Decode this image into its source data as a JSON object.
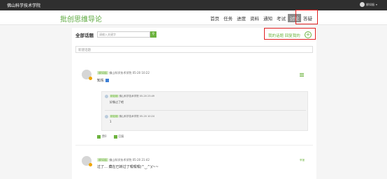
{
  "topbar": {
    "school": "佛山科学技术学院",
    "user_name": "柳如烟"
  },
  "nav": {
    "course_title": "批创思维导论",
    "items": [
      "首页",
      "任务",
      "进度",
      "资料",
      "通知",
      "考试",
      "讨论",
      "答疑"
    ],
    "active": "讨论"
  },
  "toolbar": {
    "section_title": "全部话题",
    "search_placeholder": "请输入关键字",
    "filter_mine": "我的话题",
    "filter_replied": "回复我的",
    "new_topic_placeholder": "新建话题"
  },
  "posts": [
    {
      "author": "柳如烟",
      "school": "佛山科学技术学院",
      "time": "05-20 10:22",
      "text": "知东",
      "replies": [
        {
          "author": "柳如烟",
          "school": "佛山科学技术学院",
          "time": "05-20 23:49",
          "text": "好像过了吧"
        },
        {
          "author": "柳如烟",
          "school": "佛山科学技术学院",
          "time": "05-20 10:24",
          "text": "1"
        }
      ],
      "likes": "赞0",
      "comment_label": "回复"
    },
    {
      "author": "柳如烟",
      "school": "佛山科学技术学院",
      "time": "05-20 21:42",
      "text": "过了… 藏在已转过了嘿嘿嘿(^‿^)/~~"
    }
  ],
  "labels": {
    "report": "举报"
  },
  "colors": {
    "accent": "#6db33f",
    "topbar": "#2f2f2f",
    "highlight": "#e02020"
  }
}
